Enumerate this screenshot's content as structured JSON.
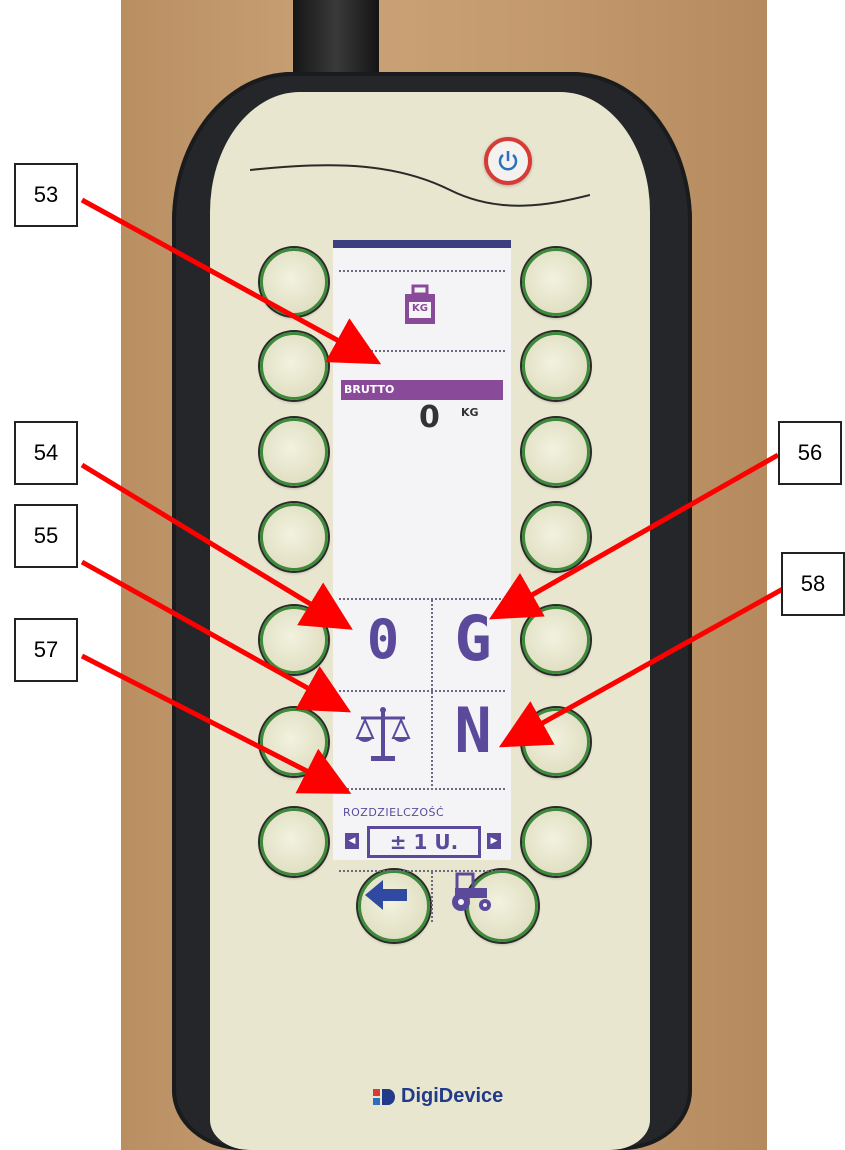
{
  "device": {
    "brand": "DigiDevice",
    "icons": {
      "power": "power-icon",
      "weight": "kg-weight-icon",
      "balance": "balance-scale-icon",
      "back": "back-arrow-icon",
      "tractor": "tractor-icon"
    }
  },
  "screen": {
    "weight_icon_text": "KG",
    "mode_label": "BRUTTO",
    "weight_value": "0",
    "weight_unit": "KG",
    "zero_key": "0",
    "gross_key": "G",
    "net_key": "N",
    "resolution_label": "ROZDZIELCZOŚĆ",
    "resolution_value": "± 1 U."
  },
  "callouts": [
    "53",
    "54",
    "55",
    "56",
    "57",
    "58"
  ],
  "colors": {
    "lcd_accent": "#5b4a9b",
    "highlight_bar": "#8a4a9a",
    "arrow": "#ff0000",
    "button_ring": "#3e8a3b"
  }
}
